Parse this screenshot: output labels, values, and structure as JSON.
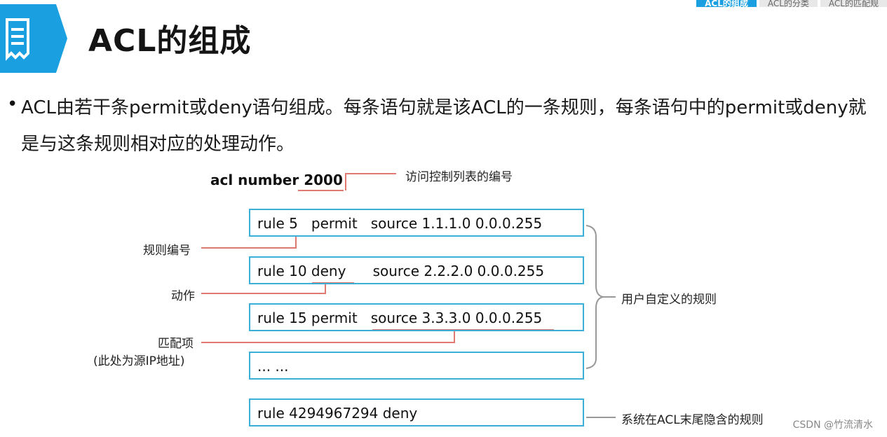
{
  "header": {
    "title": "ACL的组成",
    "breadcrumb": [
      "ACL的组成",
      "ACL的分类",
      "ACL的匹配规"
    ]
  },
  "body": {
    "text": "ACL由若干条permit或deny语句组成。每条语句就是该ACL的一条规则，每条语句中的permit或deny就是与这条规则相对应的处理动作。"
  },
  "diagram": {
    "acl_header": "acl number 2000",
    "acl_header_label": "访问控制列表的编号",
    "rules": [
      "rule 5   permit   source 1.1.1.0 0.0.0.255",
      "rule 10 deny      source 2.2.2.0 0.0.0.255",
      "rule 15 permit   source 3.3.3.0 0.0.0.255",
      "... ...",
      "rule 4294967294 deny"
    ],
    "labels": {
      "rule_number": "规则编号",
      "action": "动作",
      "match_item": "匹配项",
      "match_item_note": "(此处为源IP地址)",
      "user_defined": "用户自定义的规则",
      "implicit": "系统在ACL末尾隐含的规则"
    },
    "colors": {
      "accent": "#1aa0e0",
      "box_border": "#3ab0d8",
      "annotation_line": "#e07a70",
      "brace": "#999999"
    }
  },
  "watermark": "CSDN @竹流清水"
}
